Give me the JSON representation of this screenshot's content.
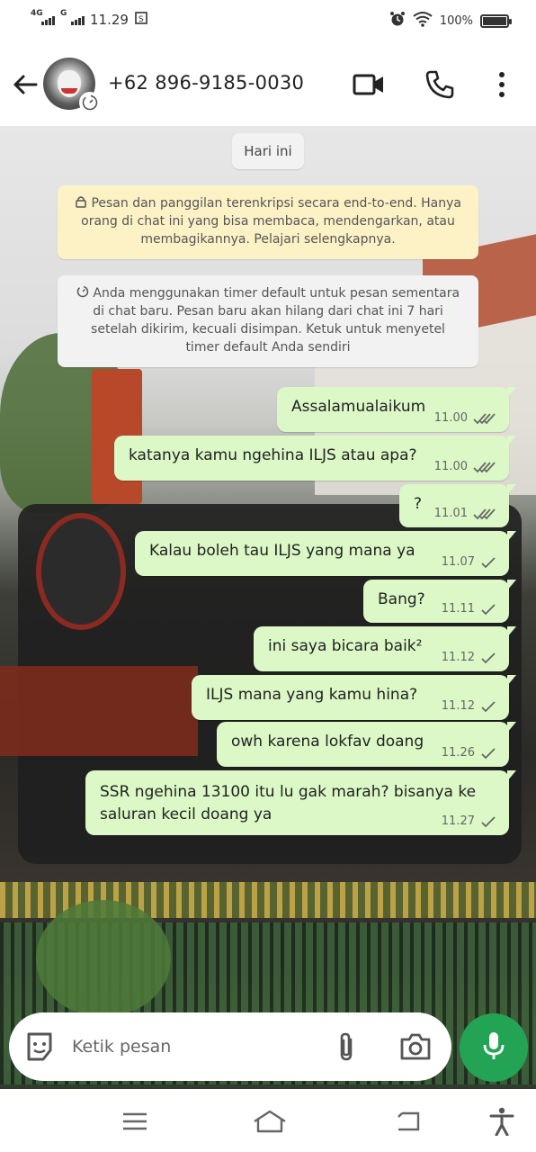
{
  "status_bar": {
    "network1": "4G",
    "network2": "G",
    "time": "11.29",
    "battery": "100%"
  },
  "header": {
    "contact_name": "+62 896-9185-0030",
    "icons": [
      "back-arrow-icon",
      "video-call-icon",
      "voice-call-icon",
      "more-options-icon"
    ]
  },
  "chat": {
    "date_label": "Hari ini",
    "encryption_notice": "Pesan dan panggilan terenkripsi secara end-to-end. Hanya orang di chat ini yang bisa membaca, mendengarkan, atau membagikannya. Pelajari selengkapnya.",
    "timer_notice": "Anda menggunakan timer default untuk pesan sementara di chat baru. Pesan baru akan hilang dari chat ini 7 hari setelah dikirim, kecuali disimpan. Ketuk untuk menyetel timer default Anda sendiri",
    "messages": [
      {
        "text": "Assalamualaikum",
        "time": "11.00",
        "status": "read"
      },
      {
        "text": "katanya kamu ngehina ILJS atau apa?",
        "time": "11.00",
        "status": "read"
      },
      {
        "text": "?",
        "time": "11.01",
        "status": "read"
      },
      {
        "text": "Kalau boleh tau ILJS yang mana ya",
        "time": "11.07",
        "status": "sent"
      },
      {
        "text": "Bang?",
        "time": "11.11",
        "status": "sent"
      },
      {
        "text": "ini saya bicara baik²",
        "time": "11.12",
        "status": "sent"
      },
      {
        "text": "ILJS mana yang kamu hina?",
        "time": "11.12",
        "status": "sent"
      },
      {
        "text": "owh karena lokfav doang",
        "time": "11.26",
        "status": "sent"
      },
      {
        "text": "SSR ngehina 13100 itu lu gak marah? bisanya ke saluran kecil doang ya",
        "time": "11.27",
        "status": "sent"
      }
    ]
  },
  "composer": {
    "placeholder": "Ketik pesan",
    "icons": [
      "emoji-sticker-icon",
      "attach-icon",
      "camera-icon",
      "mic-icon"
    ]
  },
  "colors": {
    "outgoing_bubble": "#dbf8c6",
    "mic_button": "#23a455",
    "encryption_notice_bg": "#fdf2c6",
    "tick_read": "#666666"
  },
  "navbar": {
    "icons": [
      "menu-icon",
      "home-icon",
      "back-icon",
      "accessibility-icon"
    ]
  }
}
